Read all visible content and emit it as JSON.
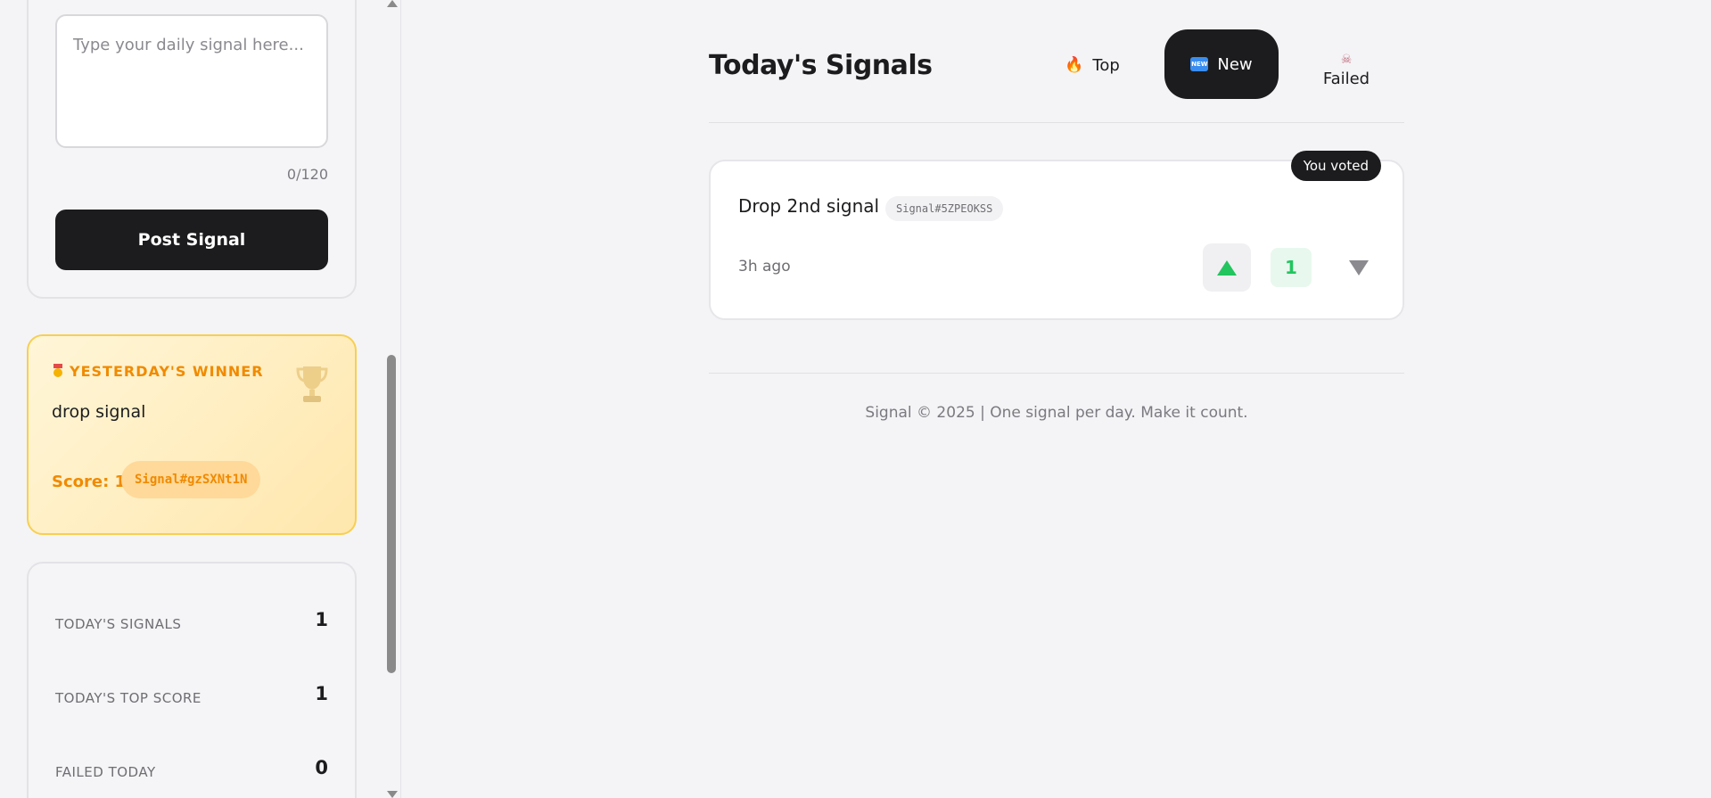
{
  "composer": {
    "placeholder": "Type your daily signal here...",
    "char_count": "0/120",
    "post_label": "Post Signal"
  },
  "winner": {
    "badge": "YESTERDAY'S WINNER",
    "text": "drop signal",
    "score_label": "Score: 1",
    "signal_id": "Signal#gzSXNt1N",
    "accent_color": "#f08a00"
  },
  "stats": [
    {
      "label": "TODAY'S SIGNALS",
      "value": "1"
    },
    {
      "label": "TODAY'S TOP SCORE",
      "value": "1"
    },
    {
      "label": "FAILED TODAY",
      "value": "0"
    }
  ],
  "main": {
    "title": "Today's Signals",
    "tabs": [
      {
        "label": "Top",
        "icon": "fire-icon",
        "active": false
      },
      {
        "label": "New",
        "icon": "new-icon",
        "active": true
      },
      {
        "label": "Failed",
        "icon": "skull-icon",
        "active": false
      }
    ]
  },
  "signals": [
    {
      "text": "Drop 2nd signal",
      "signal_id": "Signal#5ZPEOKSS",
      "time": "3h ago",
      "voted_label": "You voted",
      "score": "1"
    }
  ],
  "footer": "Signal © 2025 | One signal per day. Make it count.",
  "colors": {
    "upvote": "#22c55e",
    "dark": "#1c1c1e",
    "winner_border": "#f7cf52"
  }
}
